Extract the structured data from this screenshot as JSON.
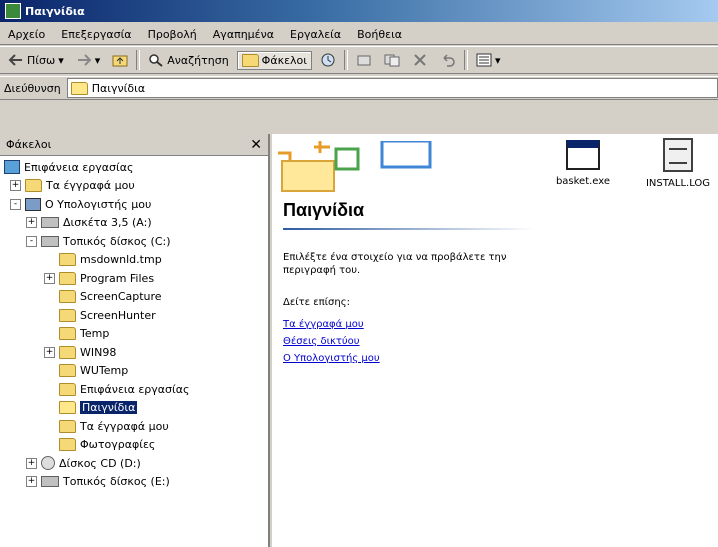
{
  "window": {
    "title": "Παιγνίδια"
  },
  "menu": [
    "Αρχείο",
    "Επεξεργασία",
    "Προβολή",
    "Αγαπημένα",
    "Εργαλεία",
    "Βοήθεια"
  ],
  "toolbar": {
    "back": "Πίσω",
    "search": "Αναζήτηση",
    "folders": "Φάκελοι"
  },
  "address": {
    "label": "Διεύθυνση",
    "value": "Παιγνίδια"
  },
  "sidebar": {
    "title": "Φάκελοι",
    "close": "✕",
    "tree": [
      {
        "label": "Επιφάνεια εργασίας"
      },
      {
        "label": "Τα έγγραφά μου",
        "expander": "+"
      },
      {
        "label": "Ο Υπολογιστής μου",
        "expander": "-"
      },
      {
        "label": "Δισκέτα 3,5 (A:)",
        "expander": "+"
      },
      {
        "label": "Τοπικός δίσκος (C:)",
        "expander": "-"
      },
      {
        "label": "msdownld.tmp"
      },
      {
        "label": "Program Files",
        "expander": "+"
      },
      {
        "label": "ScreenCapture"
      },
      {
        "label": "ScreenHunter"
      },
      {
        "label": "Temp"
      },
      {
        "label": "WIN98",
        "expander": "+"
      },
      {
        "label": "WUTemp"
      },
      {
        "label": "Επιφάνεια εργασίας"
      },
      {
        "label": "Παιγνίδια",
        "selected": true
      },
      {
        "label": "Τα έγγραφά μου"
      },
      {
        "label": "Φωτογραφίες"
      },
      {
        "label": "Δίσκος CD (D:)",
        "expander": "+"
      },
      {
        "label": "Τοπικός δίσκος (E:)",
        "expander": "+"
      }
    ]
  },
  "main": {
    "title": "Παιγνίδια",
    "description": "Επιλέξτε ένα στοιχείο για να προβάλετε την περιγραφή του.",
    "see_also": "Δείτε επίσης:",
    "links": [
      "Τα έγγραφά μου",
      "Θέσεις δικτύου",
      "Ο Υπολογιστής μου"
    ],
    "files": [
      {
        "name": "basket.exe",
        "icon": "exe-icon"
      },
      {
        "name": "INSTALL.LOG",
        "icon": "log-file-icon"
      }
    ]
  }
}
